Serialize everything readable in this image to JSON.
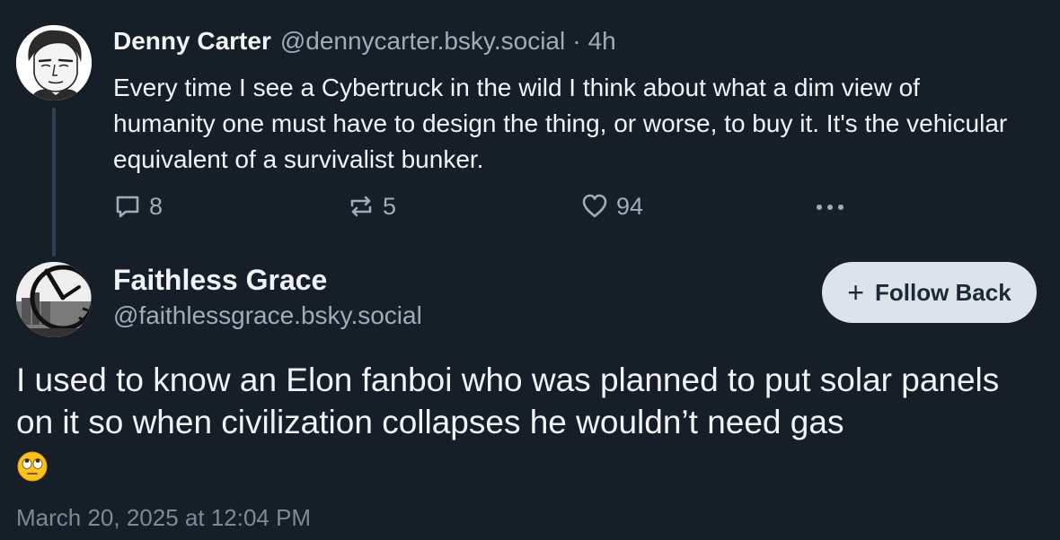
{
  "parent_post": {
    "author_name": "Denny Carter",
    "author_handle": "@dennycarter.bsky.social",
    "separator": "·",
    "time_ago": "4h",
    "text": "Every time I see a Cybertruck in the wild I think about what a dim view of humanity one must have to design the thing, or worse, to buy it. It's the vehicular equivalent of a survivalist bunker.",
    "replies_count": "8",
    "reposts_count": "5",
    "likes_count": "94",
    "icons": [
      "reply-icon",
      "repost-icon",
      "like-heart-icon",
      "more-options-icon"
    ]
  },
  "reply_post": {
    "author_name": "Faithless Grace",
    "author_handle": "@faithlessgrace.bsky.social",
    "follow_button_label": "Follow Back",
    "text": "I used to know an Elon fanboi who was planned to put solar panels on it so when civilization collapses he wouldn’t need gas",
    "emoji": "eye-roll-emoji",
    "timestamp": "March 20, 2025 at 12:04 PM"
  },
  "colors": {
    "background": "#161e27",
    "primary_text": "#f1f3f5",
    "secondary_text": "#9eacbb",
    "thread_line": "#2e4052",
    "follow_button_bg": "#dde3ea",
    "follow_button_text": "#1d2936"
  }
}
